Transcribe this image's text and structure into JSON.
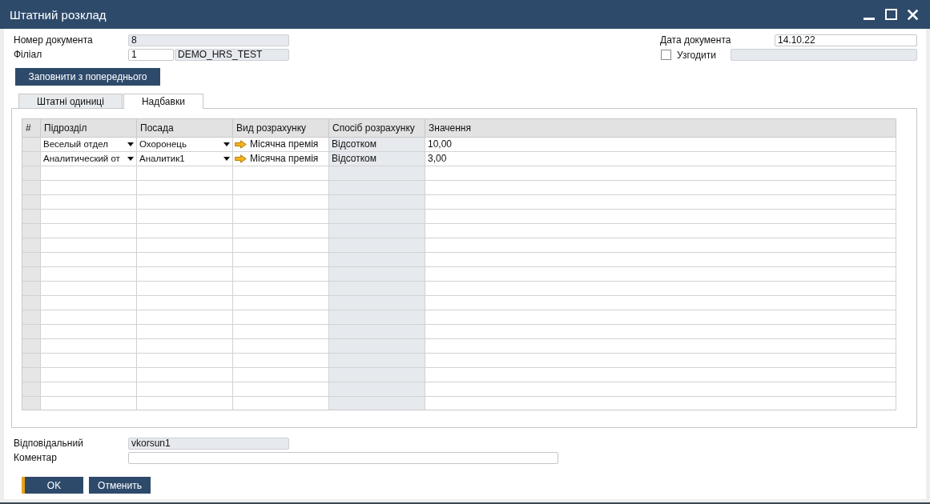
{
  "window": {
    "title": "Штатний розклад"
  },
  "left_fields": [
    {
      "label": "Номер документа",
      "inputs": [
        {
          "value": "8",
          "disabled": true
        }
      ]
    },
    {
      "label": "Філіал",
      "inputs": [
        {
          "value": "1",
          "disabled": false
        },
        {
          "value": "DEMO_HRS_TEST",
          "disabled": true
        }
      ]
    }
  ],
  "right_fields": [
    {
      "kind": "field",
      "label": "Дата документа",
      "inputs": [
        {
          "value": "14.10.22",
          "disabled": false
        }
      ]
    },
    {
      "kind": "checkbox",
      "label": "Узгодити",
      "checked": false,
      "inputs": [
        {
          "disabled": true
        }
      ]
    }
  ],
  "fill_button": {
    "label": "Заповнити з попереднього"
  },
  "tabs": [
    {
      "label": "Штатні одиниці",
      "selected": false
    },
    {
      "label": "Надбавки",
      "selected": true
    }
  ],
  "table": {
    "columns": [
      {
        "label": "#",
        "kind": "row-number"
      },
      {
        "label": "Підрозділ",
        "kind": "dropdown"
      },
      {
        "label": "Посада",
        "kind": "dropdown"
      },
      {
        "label": "Вид розрахунку",
        "kind": "link"
      },
      {
        "label": "Спосіб розрахунку",
        "kind": "readonly"
      },
      {
        "label": "Значення",
        "kind": "text"
      }
    ],
    "rows": [
      {
        "cells": [
          "",
          "Веселый отдел",
          "Охоронець",
          "Місячна премія",
          "Відсотком",
          "10,00"
        ]
      },
      {
        "cells": [
          "",
          "Аналитический от",
          "Аналитик1",
          "Місячна премія",
          "Відсотком",
          "3,00"
        ]
      }
    ]
  },
  "footer_fields": [
    {
      "label": "Відповідальний",
      "inputs": [
        {
          "value": "vkorsun1",
          "disabled": true
        }
      ]
    },
    {
      "label": "Коментар",
      "inputs": [
        {
          "disabled": false
        }
      ]
    }
  ],
  "buttons": [
    {
      "label": "OK",
      "kind": "primary"
    },
    {
      "label": "Отменить",
      "kind": "secondary"
    }
  ]
}
